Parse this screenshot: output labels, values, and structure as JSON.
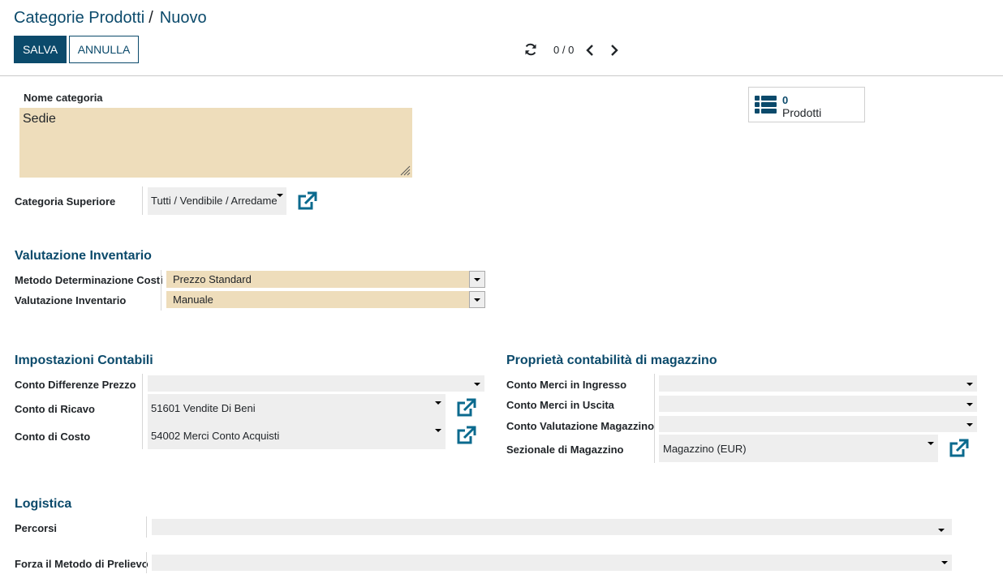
{
  "breadcrumb": {
    "parent": "Categorie Prodotti",
    "separator": "/",
    "current": "Nuovo"
  },
  "toolbar": {
    "save_label": "SALVA",
    "cancel_label": "ANNULLA"
  },
  "pager": {
    "value": "0 / 0"
  },
  "smart_button": {
    "count": "0",
    "label": "Prodotti"
  },
  "form": {
    "name_label": "Nome categoria",
    "name_value": "Sedie",
    "parent_label": "Categoria Superiore",
    "parent_value": "Tutti / Vendibile / Arredame"
  },
  "inventory_valuation": {
    "title": "Valutazione Inventario",
    "cost_method_label": "Metodo Determinazione Costi",
    "cost_method_value": "Prezzo Standard",
    "valuation_label": "Valutazione Inventario",
    "valuation_value": "Manuale"
  },
  "account_settings": {
    "title": "Impostazioni Contabili",
    "price_diff_label": "Conto Differenze Prezzo",
    "price_diff_value": "",
    "income_label": "Conto di Ricavo",
    "income_value": "51601 Vendite Di Beni",
    "expense_label": "Conto di Costo",
    "expense_value": "54002 Merci Conto Acquisti"
  },
  "stock_accounting": {
    "title": "Proprietà contabilità di magazzino",
    "input_label": "Conto Merci in Ingresso",
    "input_value": "",
    "output_label": "Conto Merci in Uscita",
    "output_value": "",
    "valuation_label": "Conto Valutazione Magazzino",
    "valuation_value": "",
    "journal_label": "Sezionale di Magazzino",
    "journal_value": "Magazzino (EUR)"
  },
  "logistics": {
    "title": "Logistica",
    "routes_label": "Percorsi",
    "routes_value": "",
    "removal_label": "Forza il Metodo di Prelievo",
    "removal_value": ""
  },
  "icons": {
    "refresh": "refresh-icon",
    "prev": "chevron-left-icon",
    "next": "chevron-right-icon",
    "list": "list-icon",
    "external": "external-link-icon"
  },
  "colors": {
    "primary": "#0b4a6b",
    "required_field": "#eeddbb",
    "field": "#eeeeee"
  }
}
